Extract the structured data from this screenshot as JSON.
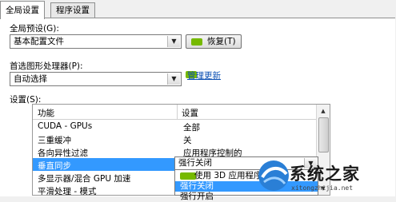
{
  "tabs": [
    {
      "label": "全局设置"
    },
    {
      "label": "程序设置"
    }
  ],
  "global_preset": {
    "label": "全局预设(G):",
    "value": "基本配置文件",
    "restore_label": "恢复(T)"
  },
  "preferred_gpu": {
    "label": "首选图形处理器(P):",
    "value": "自动选择",
    "manage_link": "管理更新"
  },
  "settings": {
    "label": "设置(S):",
    "col_feature": "功能",
    "col_setting": "设置",
    "rows": [
      {
        "feature": "CUDA - GPUs",
        "setting": "全部"
      },
      {
        "feature": "三重缓冲",
        "setting": "关"
      },
      {
        "feature": "各向异性过滤",
        "setting": "应用程序控制的"
      },
      {
        "feature": "垂直同步",
        "setting": "强行关闭"
      },
      {
        "feature": "多显示器/混合 GPU 加速",
        "setting": ""
      },
      {
        "feature": "平滑处理 - 模式",
        "setting": ""
      }
    ],
    "dropdown_options": [
      "使用 3D 应用程序设置",
      "强行关闭",
      "强行开启"
    ],
    "dropdown_selected": "强行关闭"
  },
  "watermark": {
    "text": "系统之家",
    "sub": "xitongzhijia.net"
  },
  "colors": {
    "selection": "#3399ff",
    "link": "#0b4fb3",
    "nvidia_green": "#76b900"
  }
}
